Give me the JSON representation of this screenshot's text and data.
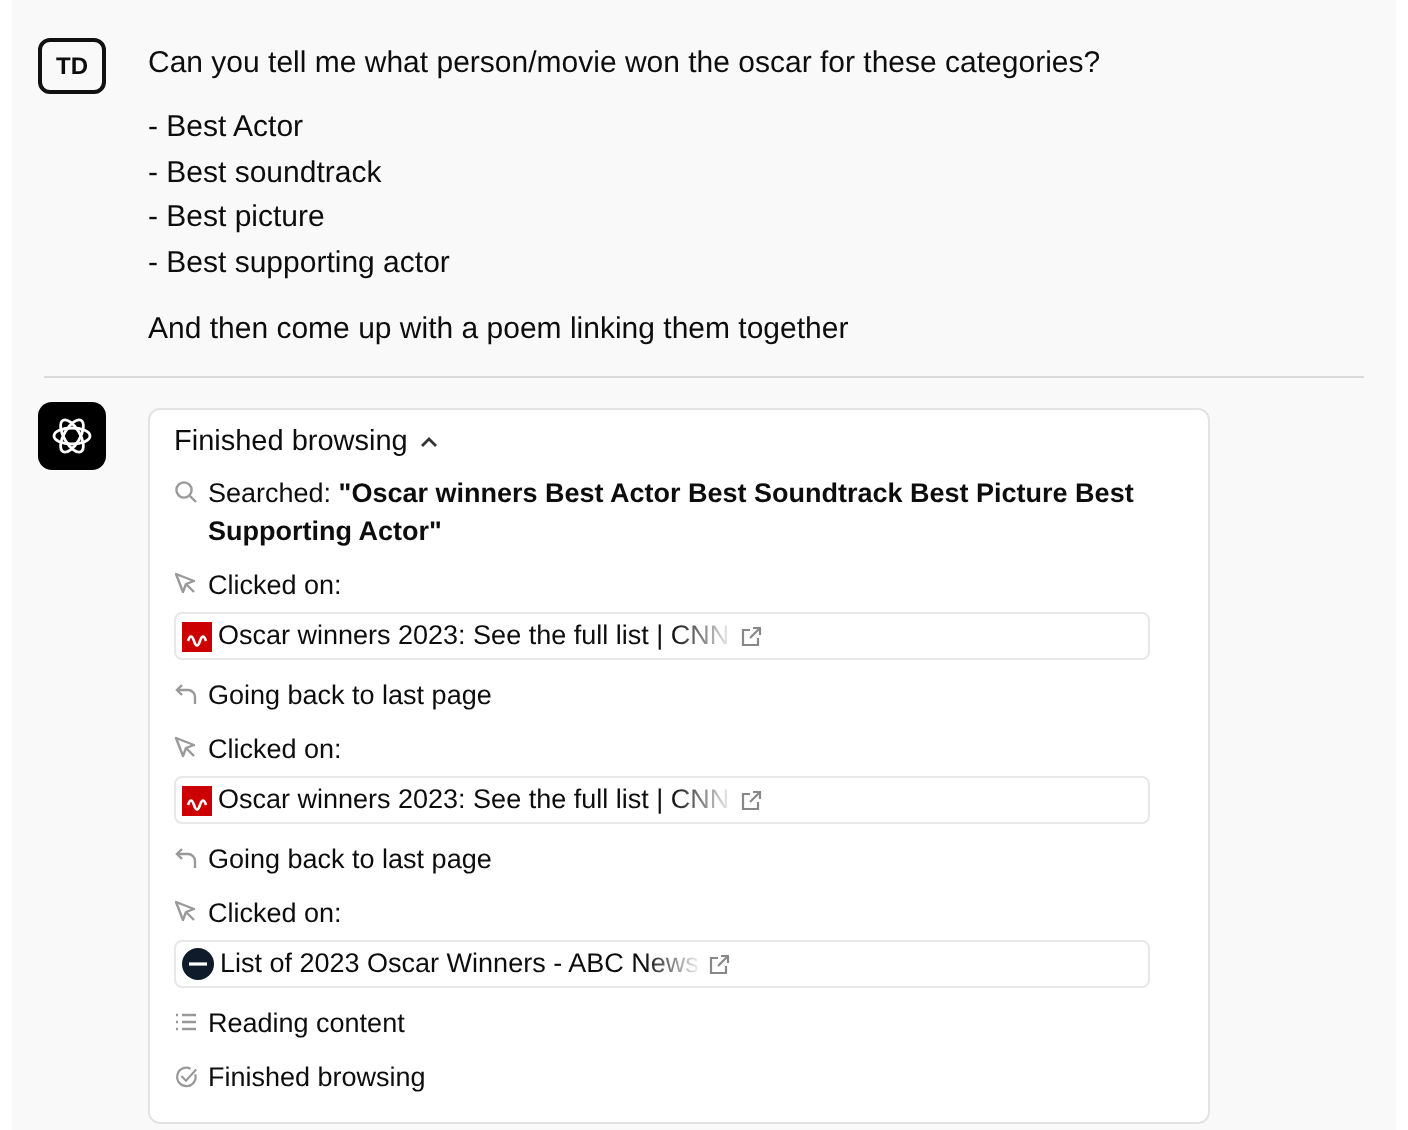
{
  "user_message": {
    "avatar": "TD",
    "paragraphs": [
      "Can you tell me what person/movie won the oscar for these categories?"
    ],
    "list": [
      "- Best Actor",
      "- Best soundtrack",
      "- Best picture",
      "- Best supporting actor"
    ],
    "closing": "And then come up with a poem linking them together"
  },
  "assistant_message": {
    "browsing": {
      "title": "Finished browsing",
      "expanded": true,
      "steps": [
        {
          "kind": "search",
          "label": "Searched: ",
          "query": "\"Oscar winners Best Actor Best Soundtrack Best Picture Best Supporting Actor\""
        },
        {
          "kind": "click",
          "label": "Clicked on:",
          "link": {
            "kind": "cnn",
            "title": "Oscar winners 2023: See the full list | CNN"
          }
        },
        {
          "kind": "back",
          "label": "Going back to last page"
        },
        {
          "kind": "click",
          "label": "Clicked on:",
          "link": {
            "kind": "cnn",
            "title": "Oscar winners 2023: See the full list | CNN"
          }
        },
        {
          "kind": "back",
          "label": "Going back to last page"
        },
        {
          "kind": "click",
          "label": "Clicked on:",
          "link": {
            "kind": "abc",
            "title": "List of 2023 Oscar Winners - ABC News"
          }
        },
        {
          "kind": "read",
          "label": "Reading content"
        },
        {
          "kind": "done",
          "label": "Finished browsing"
        }
      ]
    }
  }
}
